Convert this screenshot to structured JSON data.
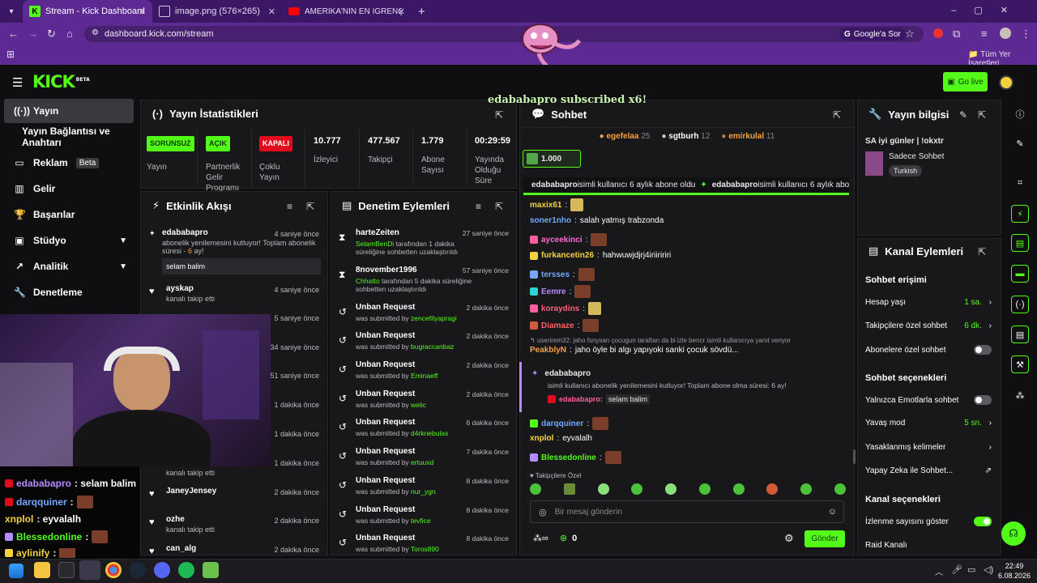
{
  "browser": {
    "tabs": [
      {
        "label": "Stream - Kick Dashboard",
        "active": true
      },
      {
        "label": "image.png (576×265)",
        "active": false
      },
      {
        "label": "AMERİKA'NIN EN İĞRENÇ PRO…",
        "active": false
      }
    ],
    "url": "dashboard.kick.com/stream",
    "google_btn": "Google'a Sor",
    "bookmarks_label": "Tüm Yer İşaretleri"
  },
  "header": {
    "logo": "KICK",
    "logo_sup": "BETA",
    "go_live": "Go live"
  },
  "sidebar": {
    "items": [
      {
        "label": "Yayın"
      },
      {
        "label": "Yayın Bağlantısı ve Anahtarı"
      },
      {
        "label": "Reklam",
        "badge": "Beta"
      },
      {
        "label": "Gelir"
      },
      {
        "label": "Başarılar"
      },
      {
        "label": "Stüdyo"
      },
      {
        "label": "Analitik"
      },
      {
        "label": "Denetleme"
      }
    ]
  },
  "stats": {
    "title": "Yayın İstatistikleri",
    "cols": [
      {
        "badge": "SORUNSUZ",
        "label": "Yayın"
      },
      {
        "badge": "AÇIK",
        "label": "Partnerlik Gelir Programı"
      },
      {
        "badge": "KAPALI",
        "label": "Çoklu Yayın"
      },
      {
        "value": "10.777",
        "label": "İzleyici"
      },
      {
        "value": "477.567",
        "label": "Takipçi"
      },
      {
        "value": "1.779",
        "label": "Abone Sayısı"
      },
      {
        "value": "00:29:59",
        "label": "Yayında Olduğu Süre"
      }
    ]
  },
  "activity": {
    "title": "Etkinlik Akışı",
    "items": [
      {
        "name": "edababapro",
        "time": "4 saniye önce",
        "sub": "abonelik yenilemesini kutluyor! Toplam abonelik süresi - ",
        "months": "6",
        "sub_end": " ay!",
        "quote": "selam balim"
      },
      {
        "name": "ayskap",
        "time": "4 saniye önce",
        "sub": "kanalı takip etti"
      },
      {
        "time": "5 saniye önce"
      },
      {
        "time": "34 saniye önce"
      },
      {
        "time": "51 saniye önce"
      },
      {
        "time": "1 dakika önce"
      },
      {
        "time": "1 dakika önce"
      },
      {
        "time": "1 dakika önce",
        "sub": "kanalı takip etti"
      },
      {
        "name": "JaneyJensey",
        "time": "2 dakika önce"
      },
      {
        "name": "ozhe",
        "time": "2 dakika önce",
        "sub": "kanalı takip etti"
      },
      {
        "name": "can_alg",
        "time": "2 dakika önce"
      }
    ]
  },
  "mod": {
    "title": "Denetim Eylemleri",
    "items": [
      {
        "name": "harteZeiten",
        "time": "27 saniye önce",
        "by": "SelamBenDi",
        "text": " tarafından 1 dakika süreliğine sohbetten uzaklaştırıldı"
      },
      {
        "name": "8november1996",
        "time": "57 saniye önce",
        "by": "Chhatto",
        "text": " tarafından 5 dakika süreliğine sohbetten uzaklaştırıldı"
      },
      {
        "name": "Unban Request",
        "time": "2 dakika önce",
        "text": "was submitted by ",
        "by": "zencefilyapragi"
      },
      {
        "name": "Unban Request",
        "time": "2 dakika önce",
        "text": "was submitted by ",
        "by": "bugraccanbaz"
      },
      {
        "name": "Unban Request",
        "time": "2 dakika önce",
        "text": "was submitted by ",
        "by": "Eminaeff"
      },
      {
        "name": "Unban Request",
        "time": "2 dakika önce",
        "text": "was submitted by ",
        "by": "welic"
      },
      {
        "name": "Unban Request",
        "time": "6 dakika önce",
        "text": "was submitted by ",
        "by": "d4rknebulas"
      },
      {
        "name": "Unban Request",
        "time": "7 dakika önce",
        "text": "was submitted by ",
        "by": "ertuuxd"
      },
      {
        "name": "Unban Request",
        "time": "8 dakika önce",
        "text": "was submitted by ",
        "by": "nur_ygn"
      },
      {
        "name": "Unban Request",
        "time": "8 dakika önce",
        "text": "was submitted by ",
        "by": "tevfice"
      },
      {
        "name": "Unban Request",
        "time": "8 dakika önce",
        "text": "was submitted by ",
        "by": "Toros890"
      }
    ]
  },
  "chat": {
    "title": "Sohbet",
    "overlay_sub": "edababapro subscribed x6!",
    "top_gifters": [
      {
        "name": "egefelaa",
        "count": "25"
      },
      {
        "name": "sgtburh",
        "count": "12"
      },
      {
        "name": "emirkulal",
        "count": "11"
      }
    ],
    "pinned_value": "1.000",
    "ticker": [
      {
        "name": "edababapro",
        "text": " isimli kullanıcı 6 aylık abone oldu"
      },
      {
        "name": "edababapro",
        "text": " isimli kullanıcı 6 aylık abo"
      }
    ],
    "messages": [
      {
        "user": "maxix61",
        "color": "#f5d142",
        "text": ""
      },
      {
        "user": "soner1nho",
        "color": "#74a7ff",
        "text": " salah yatmış trabzonda"
      },
      {
        "user": "ayceekinci",
        "color": "#ff6ad5",
        "text": ""
      },
      {
        "user": "furkancetin26",
        "color": "#f5d142",
        "text": " hahwuwjdjrj4iriiririri"
      },
      {
        "user": "tersses",
        "color": "#74a7ff",
        "text": ""
      },
      {
        "user": "Eemre",
        "color": "#b58cff",
        "text": ""
      },
      {
        "user": "koraydins",
        "color": "#ff5f7a",
        "text": ""
      },
      {
        "user": "Diamaze",
        "color": "#ff5f5f",
        "text": ""
      },
      {
        "user": "PeakblyN",
        "color": "#f5a142",
        "text": " jaho öyle bi algı yapıyoki sanki çocuk sövdü..."
      },
      {
        "user": "darqquiner",
        "color": "#74a7ff",
        "text": ""
      },
      {
        "user": "xnplol",
        "color": "#f5d142",
        "text": " eyvalalh"
      },
      {
        "user": "Blessedonline",
        "color": "#53fc18",
        "text": ""
      }
    ],
    "reply_note": "userirem32: jaho fsnysan çocugun taraftan da bi izle bencr isimli kullanıcıya yanıt veriyor",
    "sub_event": {
      "name": "edababapro",
      "text": "isimli kullanıcı abonelik yenilemesini kutluyor! Toplam abone olma süresi: 6 ay!",
      "quote_user": "edababapro:",
      "quote": "selam balim"
    },
    "followers_only": "Takipçilere Özel",
    "input_placeholder": "Bir mesaj gönderin",
    "points": "0",
    "send": "Gönder"
  },
  "info": {
    "title": "Yayın bilgisi",
    "stream_title": "SA iyi günler | !okxtr",
    "category": "Sadece Sohbet",
    "language": "Turkish"
  },
  "channel": {
    "title": "Kanal Eylemleri",
    "section1": "Sohbet erişimi",
    "rows1": [
      {
        "label": "Hesap yaşı",
        "value": "1 sa."
      },
      {
        "label": "Takipçilere özel sohbet",
        "value": "6 dk."
      },
      {
        "label": "Abonelere özel sohbet"
      }
    ],
    "section2": "Sohbet seçenekleri",
    "rows2": [
      {
        "label": "Yalnızca Emotlarla sohbet"
      },
      {
        "label": "Yavaş mod",
        "value": "5 sn."
      },
      {
        "label": "Yasaklanmış kelimeler"
      },
      {
        "label": "Yapay Zeka ile Sohbet..."
      }
    ],
    "section3": "Kanal seçenekleri",
    "rows3": [
      {
        "label": "İzlenme sayısını göster"
      },
      {
        "label": "Raid Kanalı"
      }
    ]
  },
  "overlay_chat": [
    {
      "user": "edababapro",
      "color": "#b58cff",
      "text": " : selam balim"
    },
    {
      "user": "darqquiner",
      "color": "#74a7ff",
      "text": " :"
    },
    {
      "user": "xnplol",
      "color": "#f5d142",
      "text": " : eyvalalh"
    },
    {
      "user": "Blessedonline",
      "color": "#53fc18",
      "text": " :"
    },
    {
      "user": "aylinify",
      "color": "#f5d142",
      "text": " :"
    }
  ],
  "taskbar": {
    "time": "22:49",
    "date": "6.08.2026"
  }
}
